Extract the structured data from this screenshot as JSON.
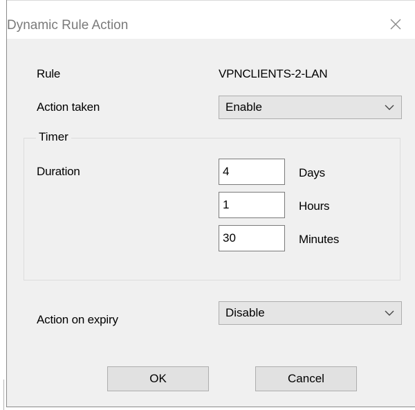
{
  "window": {
    "title": "Dynamic Rule Action",
    "close_icon": "close-icon"
  },
  "rule": {
    "label": "Rule",
    "value": "VPNCLIENTS-2-LAN"
  },
  "action_taken": {
    "label": "Action taken",
    "selected": "Enable"
  },
  "timer": {
    "group_label": "Timer",
    "duration_label": "Duration",
    "fields": [
      {
        "value": "4",
        "unit": "Days"
      },
      {
        "value": "1",
        "unit": "Hours"
      },
      {
        "value": "30",
        "unit": "Minutes"
      }
    ]
  },
  "action_on_expiry": {
    "label": "Action on expiry",
    "selected": "Disable"
  },
  "buttons": {
    "ok_label": "OK",
    "cancel_label": "Cancel"
  }
}
